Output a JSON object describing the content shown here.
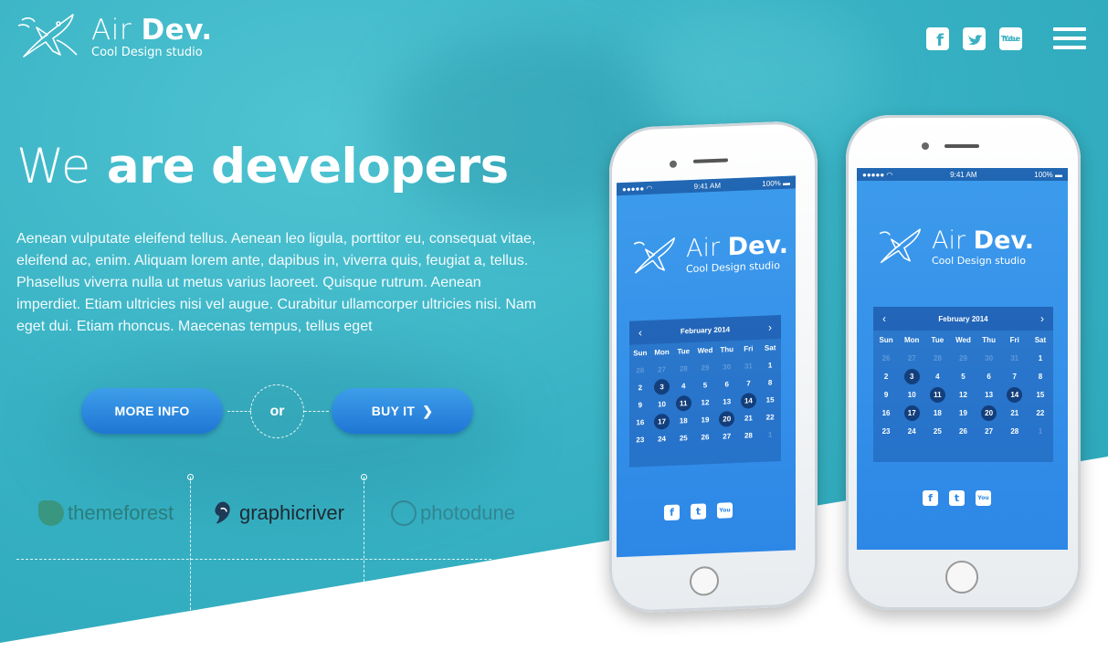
{
  "brand": {
    "name_light": "Air",
    "name_bold": "Dev.",
    "tagline": "Cool Design studio"
  },
  "social": {
    "facebook": "f",
    "twitter": "t",
    "youtube_top": "You",
    "youtube_bottom": "Tube"
  },
  "hero": {
    "headline_light": "We",
    "headline_bold": "are developers",
    "intro": "Aenean vulputate eleifend tellus. Aenean leo ligula, porttitor eu, consequat vitae, eleifend ac, enim. Aliquam lorem ante, dapibus in, viverra quis, feugiat a, tellus. Phasellus viverra nulla ut metus varius laoreet. Quisque rutrum. Aenean imperdiet. Etiam ultricies nisi vel augue. Curabitur ullamcorper ultricies nisi. Nam eget dui. Etiam rhoncus. Maecenas tempus, tellus eget"
  },
  "buttons": {
    "more_info": "MORE INFO",
    "or": "or",
    "buy_it": "BUY IT"
  },
  "partners": {
    "themeforest": "themeforest",
    "graphicriver": "graphicriver",
    "photodune": "photodune"
  },
  "phone_screen": {
    "time": "9:41 AM",
    "signal": "●●●●● ◠",
    "battery": "100% ▬",
    "month": "February 2014",
    "prev": "‹",
    "next": "›",
    "weekdays": [
      "Sun",
      "Mon",
      "Tue",
      "Wed",
      "Thu",
      "Fri",
      "Sat"
    ],
    "days": [
      [
        "26",
        "dim"
      ],
      [
        "27",
        "dim"
      ],
      [
        "28",
        "dim"
      ],
      [
        "29",
        "dim"
      ],
      [
        "30",
        "dim"
      ],
      [
        "31",
        "dim"
      ],
      [
        "1",
        ""
      ],
      [
        "2",
        ""
      ],
      [
        "3",
        "mark"
      ],
      [
        "4",
        ""
      ],
      [
        "5",
        ""
      ],
      [
        "6",
        ""
      ],
      [
        "7",
        ""
      ],
      [
        "8",
        ""
      ],
      [
        "9",
        ""
      ],
      [
        "10",
        ""
      ],
      [
        "11",
        "mark"
      ],
      [
        "12",
        ""
      ],
      [
        "13",
        ""
      ],
      [
        "14",
        "mark"
      ],
      [
        "15",
        ""
      ],
      [
        "16",
        ""
      ],
      [
        "17",
        "mark"
      ],
      [
        "18",
        ""
      ],
      [
        "19",
        ""
      ],
      [
        "20",
        "mark"
      ],
      [
        "21",
        ""
      ],
      [
        "22",
        ""
      ],
      [
        "23",
        ""
      ],
      [
        "24",
        ""
      ],
      [
        "25",
        ""
      ],
      [
        "26",
        ""
      ],
      [
        "27",
        ""
      ],
      [
        "28",
        ""
      ],
      [
        "1",
        "dim"
      ]
    ]
  },
  "colors": {
    "hero_teal": "#38b2c4",
    "button_blue": "#2a86df",
    "screen_blue": "#3d9bec"
  }
}
